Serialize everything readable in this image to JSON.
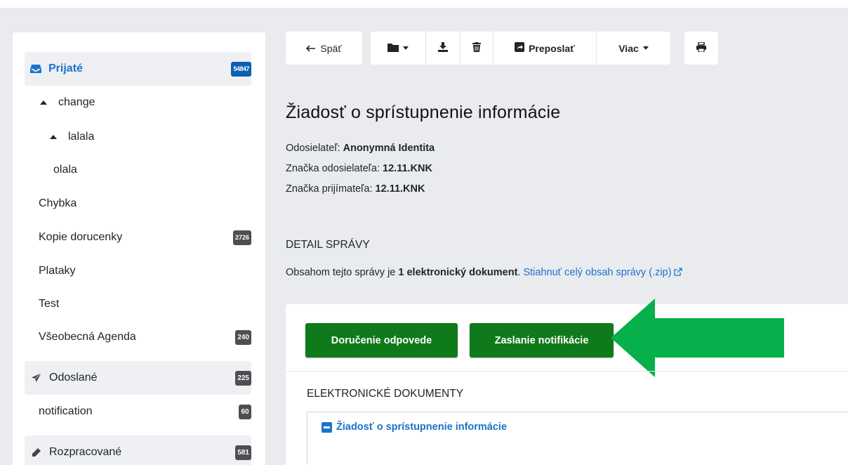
{
  "sidebar": {
    "items": [
      {
        "label": "Prijaté",
        "badge": "54847",
        "icon": "inbox-icon",
        "section": true
      },
      {
        "label": "change",
        "icon": "caret-up-icon"
      },
      {
        "label": "lalala",
        "icon": "caret-up-icon"
      },
      {
        "label": "olala"
      },
      {
        "label": "Chybka"
      },
      {
        "label": "Kopie dorucenky",
        "badge": "2726"
      },
      {
        "label": "Plataky"
      },
      {
        "label": "Test"
      },
      {
        "label": "Všeobecná Agenda",
        "badge": "240"
      },
      {
        "label": "Odoslané",
        "badge": "225",
        "icon": "paper-plane-icon",
        "section": true
      },
      {
        "label": "notification",
        "badge": "60"
      },
      {
        "label": "Rozpracované",
        "badge": "581",
        "icon": "pencil-icon",
        "section": true
      }
    ]
  },
  "toolbar": {
    "back_label": "Späť",
    "forward_label": "Preposlať",
    "more_label": "Viac"
  },
  "message": {
    "title": "Žiadosť o sprístupnenie informácie",
    "sender_label": "Odosielateľ:",
    "sender_value": "Anonymná Identita",
    "sender_ref_label": "Značka odosielateľa:",
    "sender_ref_value": "12.11.KNK",
    "recipient_ref_label": "Značka prijímateľa:",
    "recipient_ref_value": "12.11.KNK",
    "detail_heading": "DETAIL SPRÁVY",
    "content_prefix": "Obsahom tejto správy je",
    "content_count": "1 elektronický dokument",
    "content_suffix": ".",
    "download_link": "Stiahnuť celý obsah správy (.zip)"
  },
  "actions": {
    "delivery_label": "Doručenie odpovede",
    "notify_label": "Zaslanie notifikácie"
  },
  "documents": {
    "heading": "ELEKTRONICKÉ DOKUMENTY",
    "items": [
      {
        "label": "Žiadosť o sprístupnenie informácie"
      }
    ]
  },
  "colors": {
    "accent": "#1b73c9",
    "action_green": "#0f7a1a",
    "annotation_arrow": "#06b04a",
    "badge_dark": "#4d4f52",
    "badge_blue": "#0d5fb3"
  }
}
